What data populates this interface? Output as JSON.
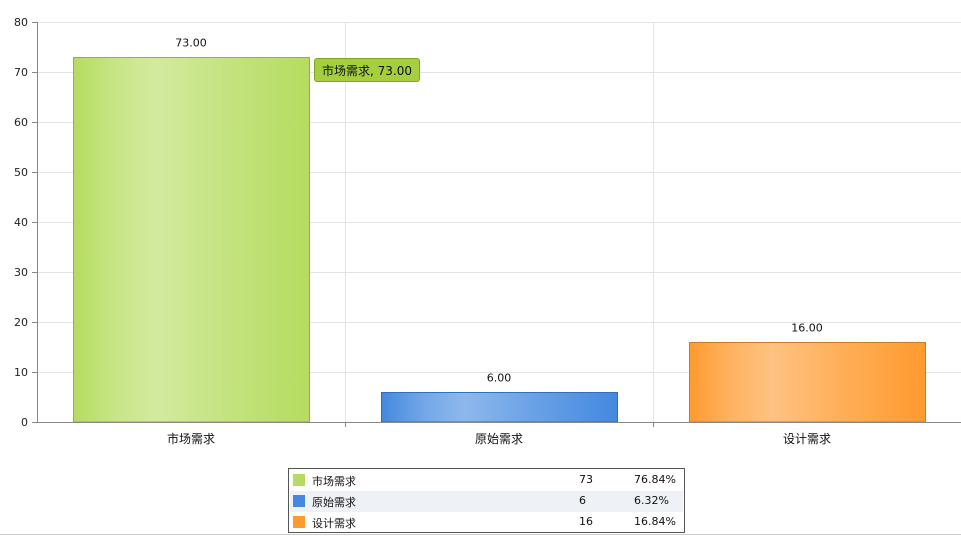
{
  "chart_data": {
    "type": "bar",
    "categories": [
      "市场需求",
      "原始需求",
      "设计需求"
    ],
    "values": [
      73,
      6,
      16
    ],
    "value_labels": [
      "73.00",
      "6.00",
      "16.00"
    ],
    "colors": [
      "#b5dc5f",
      "#4389e0",
      "#ff9a2e"
    ],
    "ylim": [
      0,
      80
    ],
    "yticks": [
      0,
      10,
      20,
      30,
      40,
      50,
      60,
      70,
      80
    ],
    "grid": true,
    "legend_placement": "bottom"
  },
  "tooltip": {
    "text": "市场需求, 73.00"
  },
  "legend": {
    "rows": [
      {
        "name": "市场需求",
        "value": "73",
        "percent": "76.84%",
        "color": "#b5dc5f"
      },
      {
        "name": "原始需求",
        "value": "6",
        "percent": "6.32%",
        "color": "#4389e0"
      },
      {
        "name": "设计需求",
        "value": "16",
        "percent": "16.84%",
        "color": "#ff9a2e"
      }
    ]
  }
}
